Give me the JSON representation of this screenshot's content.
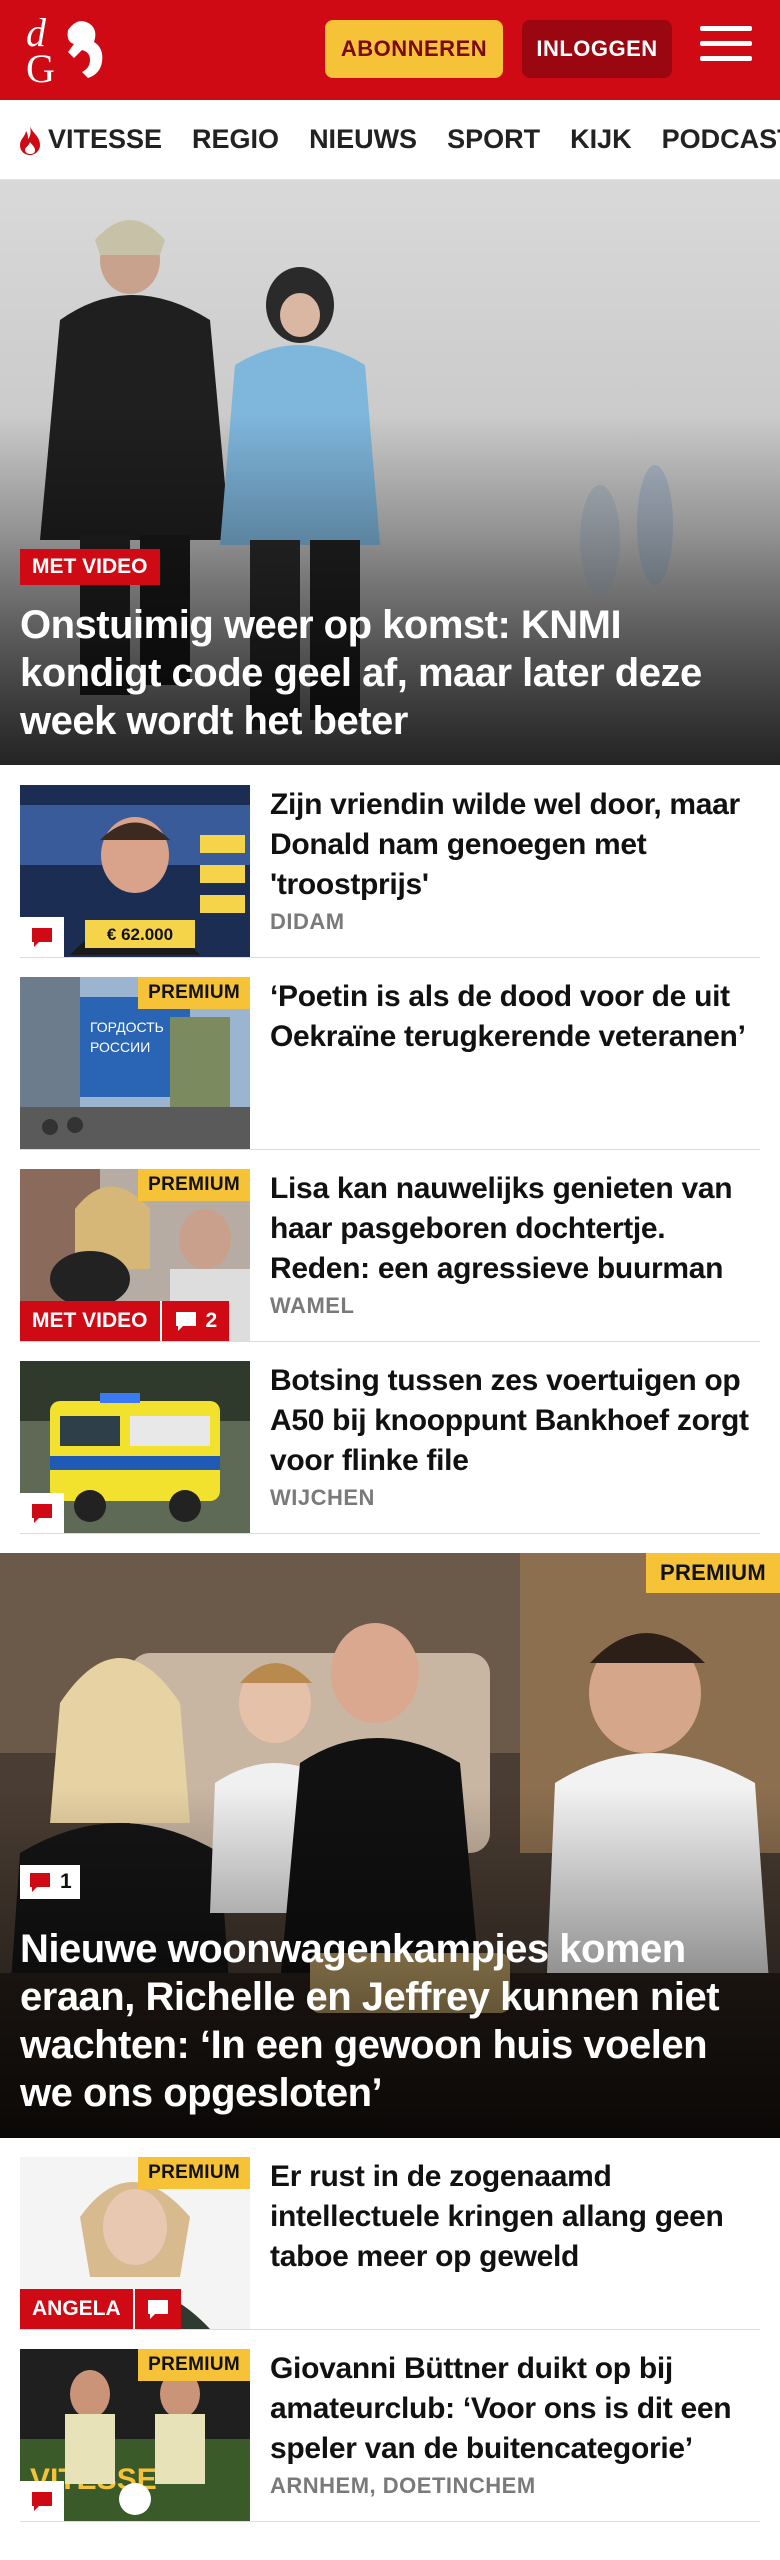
{
  "header": {
    "logo_text": "dG",
    "subscribe_label": "ABONNEREN",
    "login_label": "INLOGGEN",
    "menu_icon": "hamburger-menu-icon"
  },
  "nav": {
    "items": [
      {
        "label": "VITESSE",
        "icon": "flame-icon"
      },
      {
        "label": "REGIO"
      },
      {
        "label": "NIEUWS"
      },
      {
        "label": "SPORT"
      },
      {
        "label": "KIJK"
      },
      {
        "label": "PODCAST"
      }
    ]
  },
  "hero1": {
    "tag": "MET VIDEO",
    "title": "Onstuimig weer op komst: KNMI kondigt code geel af, maar later deze week wordt het beter"
  },
  "articles1": [
    {
      "title": "Zijn vriendin wilde wel door, maar Donald nam genoegen met 'troostprijs'",
      "location": "DIDAM",
      "premium": "",
      "video": "",
      "comments": "",
      "overlay_text": "€ 62.000"
    },
    {
      "title": "‘Poetin is als de dood voor de uit Oekraïne terugkerende veteranen’",
      "location": "",
      "premium": "PREMIUM",
      "video": "",
      "comments": ""
    },
    {
      "title": "Lisa kan nauwelijks genieten van haar pasgeboren dochtertje. Reden: een agressieve buurman",
      "location": "WAMEL",
      "premium": "PREMIUM",
      "video": "MET VIDEO",
      "comments": "2"
    },
    {
      "title": "Botsing tussen zes voertuigen op A50 bij knooppunt Bankhoef zorgt voor flinke file",
      "location": "WIJCHEN",
      "premium": "",
      "video": "",
      "comments": ""
    }
  ],
  "hero2": {
    "premium": "PREMIUM",
    "comments": "1",
    "title": "Nieuwe woonwagenkampjes komen eraan, Richelle en Jeffrey kunnen niet wachten: ‘In een gewoon huis voelen we ons opgesloten’"
  },
  "articles2": [
    {
      "title": "Er rust in de zogenaamd intellectuele kringen allang geen taboe meer op geweld",
      "location": "",
      "premium": "PREMIUM",
      "author": "ANGELA"
    },
    {
      "title": "Giovanni Büttner duikt op bij amateurclub: ‘Voor ons is dit een speler van de buitencategorie’",
      "location": "ARNHEM, DOETINCHEM",
      "premium": "PREMIUM",
      "author": ""
    }
  ],
  "colors": {
    "brand_red": "#cf0a15",
    "premium_yellow": "#f5c238",
    "dark_red": "#9b0711"
  }
}
